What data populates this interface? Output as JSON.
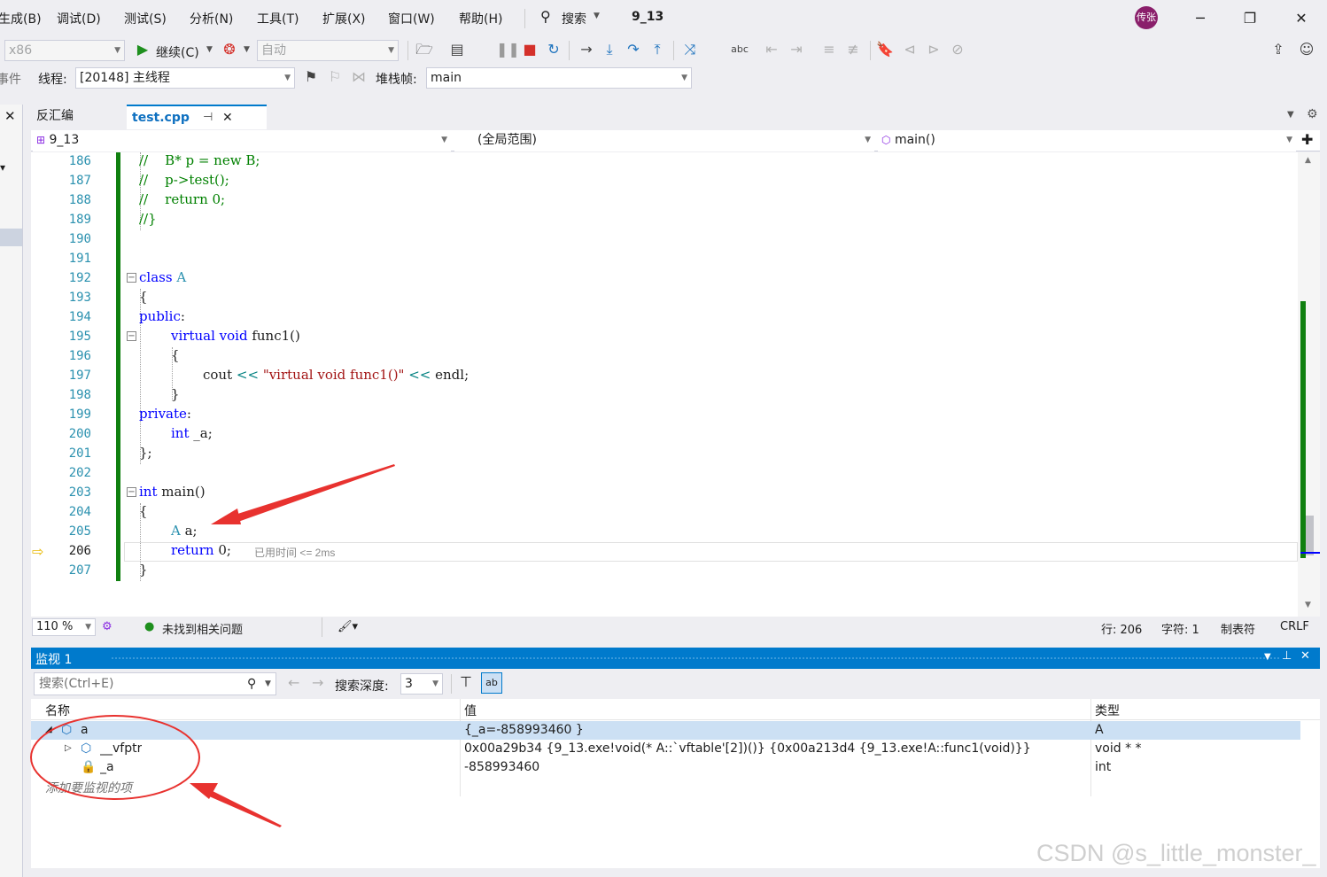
{
  "menu": {
    "items": [
      "生成(B)",
      "调试(D)",
      "测试(S)",
      "分析(N)",
      "工具(T)",
      "扩展(X)",
      "窗口(W)",
      "帮助(H)"
    ],
    "search_label": "搜索",
    "solution_name": "9_13",
    "avatar_text": "传张"
  },
  "toolbar": {
    "platform": "x86",
    "continue_label": "继续(C)",
    "auto_label": "自动"
  },
  "debugbar": {
    "process_label": "事件",
    "thread_label": "线程:",
    "thread_value": "[20148] 主线程",
    "stackframe_label": "堆栈帧:",
    "stackframe_value": "main"
  },
  "tabs": {
    "disasm": "反汇编",
    "active": "test.cpp"
  },
  "navbar": {
    "project": "9_13",
    "scope": "(全局范围)",
    "member": "main()"
  },
  "editor": {
    "line_numbers": [
      "186",
      "187",
      "188",
      "189",
      "190",
      "191",
      "192",
      "193",
      "194",
      "195",
      "196",
      "197",
      "198",
      "199",
      "200",
      "201",
      "202",
      "203",
      "204",
      "205",
      "206",
      "207"
    ],
    "current_line": "206",
    "elapsed_note": "已用时间 <= 2ms"
  },
  "status": {
    "zoom": "110 %",
    "issues": "未找到相关问题",
    "line": "行: 206",
    "char": "字符: 1",
    "tabs": "制表符",
    "eol": "CRLF"
  },
  "watch": {
    "title": "监视 1",
    "search_placeholder": "搜索(Ctrl+E)",
    "depth_label": "搜索深度:",
    "depth_value": "3",
    "columns": [
      "名称",
      "值",
      "类型"
    ],
    "rows": [
      {
        "name": "a",
        "value": "{_a=-858993460 }",
        "type": "A"
      },
      {
        "name": "__vfptr",
        "value": "0x00a29b34 {9_13.exe!void(* A::`vftable'[2])()} {0x00a213d4 {9_13.exe!A::func1(void)}}",
        "type": "void * *"
      },
      {
        "name": "_a",
        "value": "-858993460",
        "type": "int"
      }
    ],
    "add_item": "添加要监视的项"
  },
  "watermark": "CSDN @s_little_monster_",
  "colors": {
    "accent": "#007acc",
    "change_bar": "#108010",
    "annotation": "#e8322f"
  }
}
